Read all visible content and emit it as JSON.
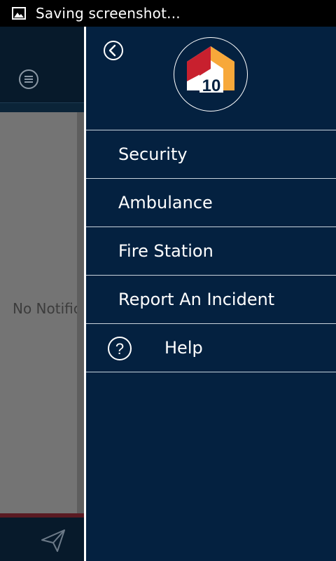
{
  "status_bar": {
    "icon": "image-icon",
    "text": "Saving screenshot..."
  },
  "background": {
    "menu_icon": "menu-lines-icon",
    "empty_text": "No Notificat",
    "send_icon": "send-paper-plane-icon"
  },
  "drawer": {
    "back_icon": "chevron-left-circle-icon",
    "logo": {
      "text": "10",
      "colors": {
        "red": "#c8202e",
        "orange": "#f7a83a",
        "white": "#ffffff"
      }
    },
    "items": [
      {
        "label": "Security"
      },
      {
        "label": "Ambulance"
      },
      {
        "label": "Fire Station"
      },
      {
        "label": "Report An Incident"
      },
      {
        "label": "Help",
        "icon": "question-circle-icon"
      }
    ]
  },
  "colors": {
    "drawer_bg": "#042140",
    "divider": "#c9d3dc",
    "status_bar": "#000000",
    "content_overlay": "#747474"
  }
}
